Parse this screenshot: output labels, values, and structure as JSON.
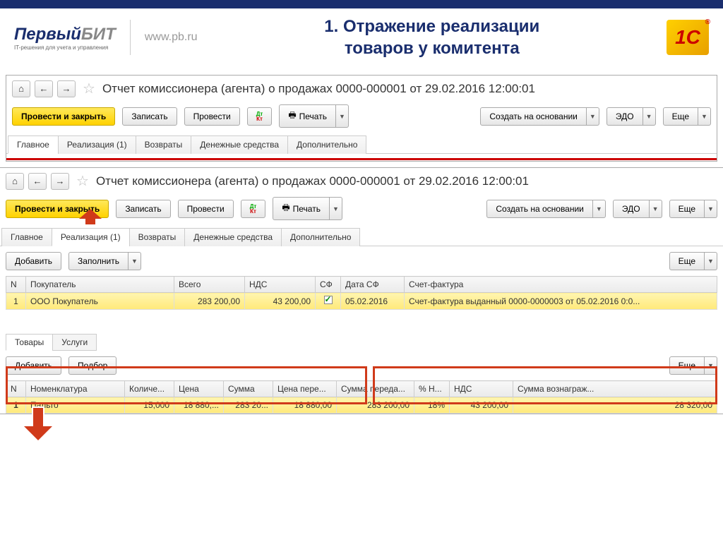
{
  "header": {
    "logo_first": "Первый",
    "logo_second": "БИТ",
    "tagline": "IT-решения для учета и управления",
    "url": "www.pb.ru",
    "slide_title_l1": "1. Отражение реализации",
    "slide_title_l2": "товаров у комитента",
    "logo_1c": "1C"
  },
  "win1": {
    "doc_title": "Отчет комиссионера (агента) о продажах 0000-000001 от 29.02.2016 12:00:01",
    "toolbar": {
      "post_close": "Провести и закрыть",
      "save": "Записать",
      "post": "Провести",
      "print": "Печать",
      "create_based": "Создать на основании",
      "edo": "ЭДО",
      "more": "Еще"
    },
    "tabs": [
      "Главное",
      "Реализация (1)",
      "Возвраты",
      "Денежные средства",
      "Дополнительно"
    ]
  },
  "win2": {
    "doc_title": "Отчет комиссионера (агента) о продажах 0000-000001 от 29.02.2016 12:00:01",
    "toolbar": {
      "post_close": "Провести и закрыть",
      "save": "Записать",
      "post": "Провести",
      "print": "Печать",
      "create_based": "Создать на основании",
      "edo": "ЭДО",
      "more": "Еще"
    },
    "tabs": [
      "Главное",
      "Реализация (1)",
      "Возвраты",
      "Денежные средства",
      "Дополнительно"
    ],
    "subbar": {
      "add": "Добавить",
      "fill": "Заполнить",
      "more": "Еще"
    },
    "table1": {
      "headers": [
        "N",
        "Покупатель",
        "Всего",
        "НДС",
        "СФ",
        "Дата СФ",
        "Счет-фактура"
      ],
      "row": {
        "n": "1",
        "buyer": "ООО Покупатель",
        "total": "283 200,00",
        "vat": "43 200,00",
        "sf_checked": true,
        "date_sf": "05.02.2016",
        "invoice": "Счет-фактура выданный 0000-0000003 от 05.02.2016 0:0..."
      }
    },
    "tabs2": [
      "Товары",
      "Услуги"
    ],
    "subbar2": {
      "add": "Добавить",
      "pick": "Подбор",
      "more": "Еще"
    },
    "table2": {
      "headers": [
        "N",
        "Номенклатура",
        "Количе...",
        "Цена",
        "Сумма",
        "Цена пере...",
        "Сумма переда...",
        "% Н...",
        "НДС",
        "Сумма вознаграж..."
      ],
      "row": {
        "n": "1",
        "nom": "Пальто",
        "qty": "15,000",
        "price": "18 880,...",
        "sum": "283 20...",
        "price_tr": "18 880,00",
        "sum_tr": "283 200,00",
        "vat_pct": "18%",
        "vat": "43 200,00",
        "reward": "28 320,00"
      }
    }
  }
}
